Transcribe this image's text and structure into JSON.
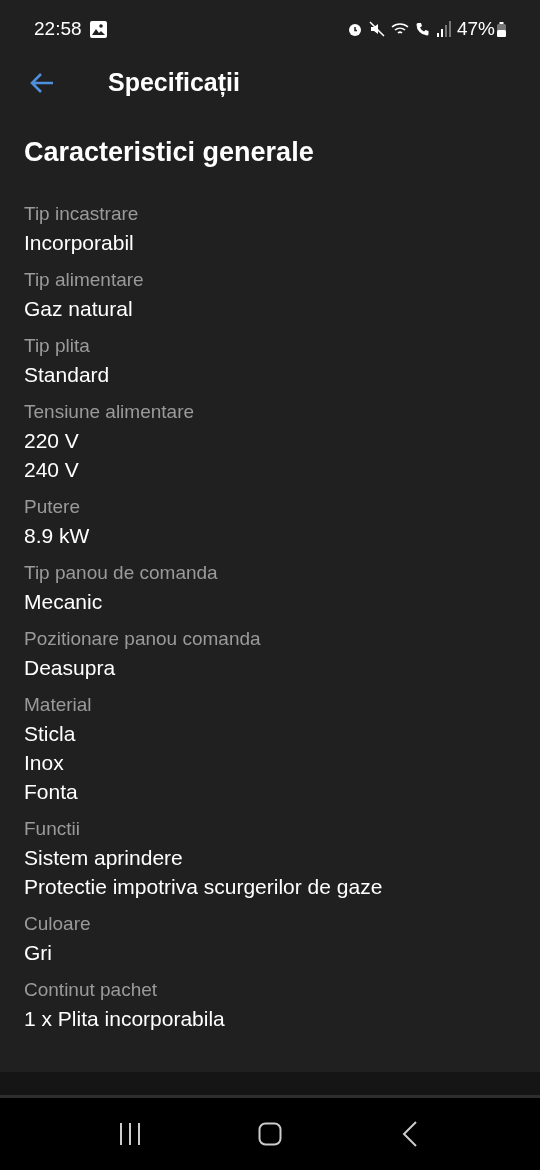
{
  "status_bar": {
    "time": "22:58",
    "battery": "47%"
  },
  "header": {
    "title": "Specificații"
  },
  "section": {
    "title": "Caracteristici generale",
    "specs": [
      {
        "label": "Tip incastrare",
        "values": [
          "Incorporabil"
        ]
      },
      {
        "label": "Tip alimentare",
        "values": [
          "Gaz natural"
        ]
      },
      {
        "label": "Tip plita",
        "values": [
          "Standard"
        ]
      },
      {
        "label": "Tensiune alimentare",
        "values": [
          "220 V",
          "240 V"
        ]
      },
      {
        "label": "Putere",
        "values": [
          "8.9 kW"
        ]
      },
      {
        "label": "Tip panou de comanda",
        "values": [
          "Mecanic"
        ]
      },
      {
        "label": "Pozitionare panou comanda",
        "values": [
          "Deasupra"
        ]
      },
      {
        "label": "Material",
        "values": [
          "Sticla",
          "Inox",
          "Fonta"
        ]
      },
      {
        "label": "Functii",
        "values": [
          "Sistem aprindere",
          "Protectie impotriva scurgerilor de gaze"
        ]
      },
      {
        "label": "Culoare",
        "values": [
          "Gri"
        ]
      },
      {
        "label": "Continut pachet",
        "values": [
          "1 x Plita incorporabila"
        ]
      }
    ]
  }
}
